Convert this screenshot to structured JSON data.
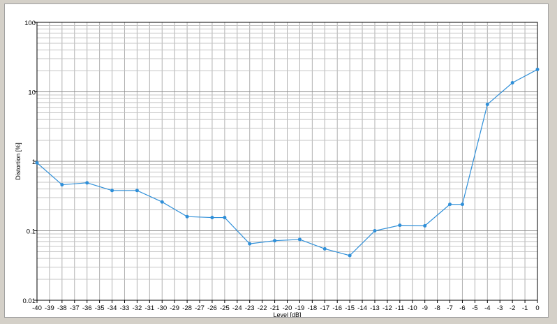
{
  "chart_data": {
    "type": "line",
    "title": "",
    "xlabel": "Level [dB]",
    "ylabel": "Distortion [%]",
    "xlim": [
      -40,
      0
    ],
    "ylim": [
      0.01,
      100
    ],
    "yscale": "log",
    "grid": true,
    "x_ticks": [
      "-40",
      "-39",
      "-38",
      "-37",
      "-36",
      "-35",
      "-34",
      "-33",
      "-32",
      "-31",
      "-30",
      "-29",
      "-28",
      "-27",
      "-26",
      "-25",
      "-24",
      "-23",
      "-22",
      "-21",
      "-20",
      "-19",
      "-18",
      "-17",
      "-16",
      "-15",
      "-14",
      "-13",
      "-12",
      "-11",
      "-10",
      "-9",
      "-8",
      "-7",
      "-6",
      "-5",
      "-4",
      "-3",
      "-2",
      "-1",
      "0"
    ],
    "y_ticks": [
      "0.01",
      "0.1",
      "1",
      "10",
      "100"
    ],
    "series": [
      {
        "x": [
          -40,
          -38,
          -36,
          -34,
          -32,
          -30,
          -28,
          -26,
          -25,
          -23,
          -21,
          -19,
          -17,
          -15,
          -13,
          -11,
          -9,
          -7,
          -6,
          -4,
          -2,
          0
        ],
        "y": [
          0.95,
          0.46,
          0.49,
          0.38,
          0.38,
          0.26,
          0.16,
          0.155,
          0.155,
          0.065,
          0.072,
          0.075,
          0.055,
          0.044,
          0.1,
          0.12,
          0.118,
          0.24,
          0.24,
          6.6,
          13.5,
          21
        ],
        "color": "#2f8fd8"
      }
    ]
  }
}
